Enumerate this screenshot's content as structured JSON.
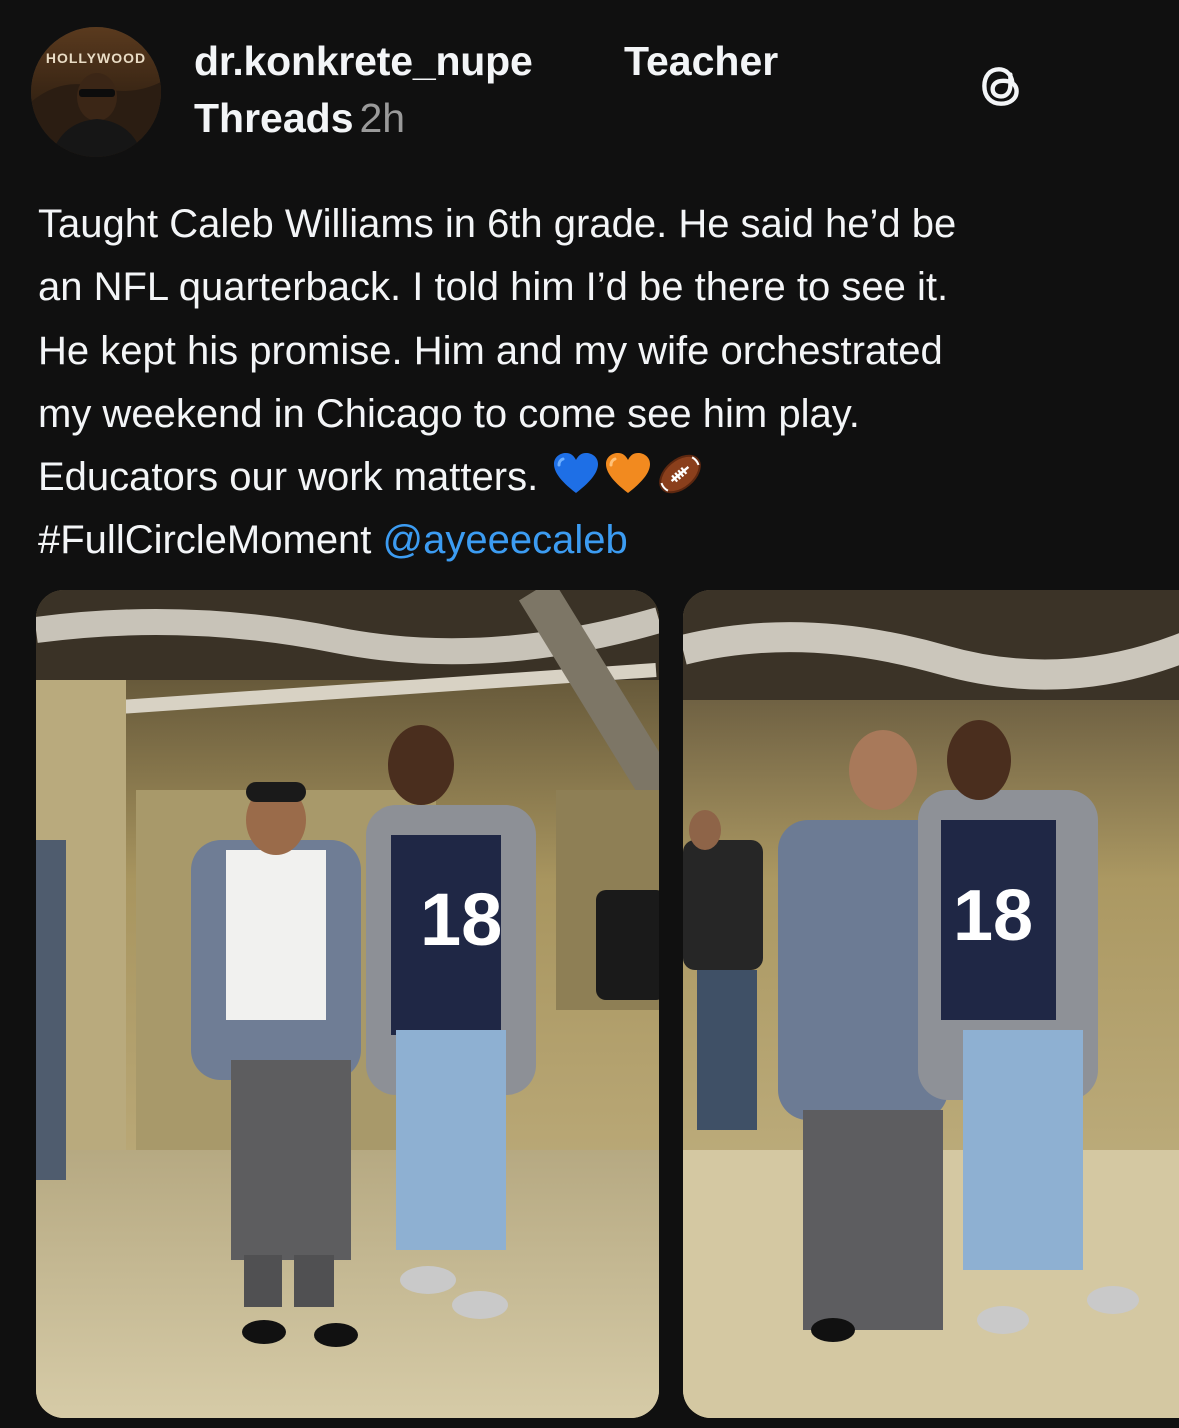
{
  "post": {
    "author": {
      "username": "dr.konkrete_nupe",
      "role_tag": "Teacher",
      "avatar_text": "HOLLYWOOD"
    },
    "platform": "Threads",
    "timestamp": "2h",
    "platform_icon": "threads-logo-icon",
    "body": {
      "line1": "Taught Caleb Williams in 6th grade. He said he’d be",
      "line2": "an NFL quarterback. I told him I’d be there to see it.",
      "line3": "He kept his promise. Him and my wife orchestrated",
      "line4": "my weekend in Chicago to come see him play.",
      "line5": "Educators our work matters.",
      "emojis": [
        "blue-heart-icon",
        "orange-heart-icon",
        "football-icon"
      ],
      "hashtag": "#FullCircleMoment",
      "mention": "@ayeeecaleb"
    },
    "photos": [
      {
        "jersey_number": "18"
      },
      {
        "jersey_number": "18"
      }
    ]
  },
  "colors": {
    "background": "#101010",
    "text": "#f3f5f7",
    "secondary_text": "#9a9a9a",
    "mention": "#3c9cf2",
    "heart_blue": "#1e6fe6",
    "heart_orange": "#f28a1f"
  }
}
